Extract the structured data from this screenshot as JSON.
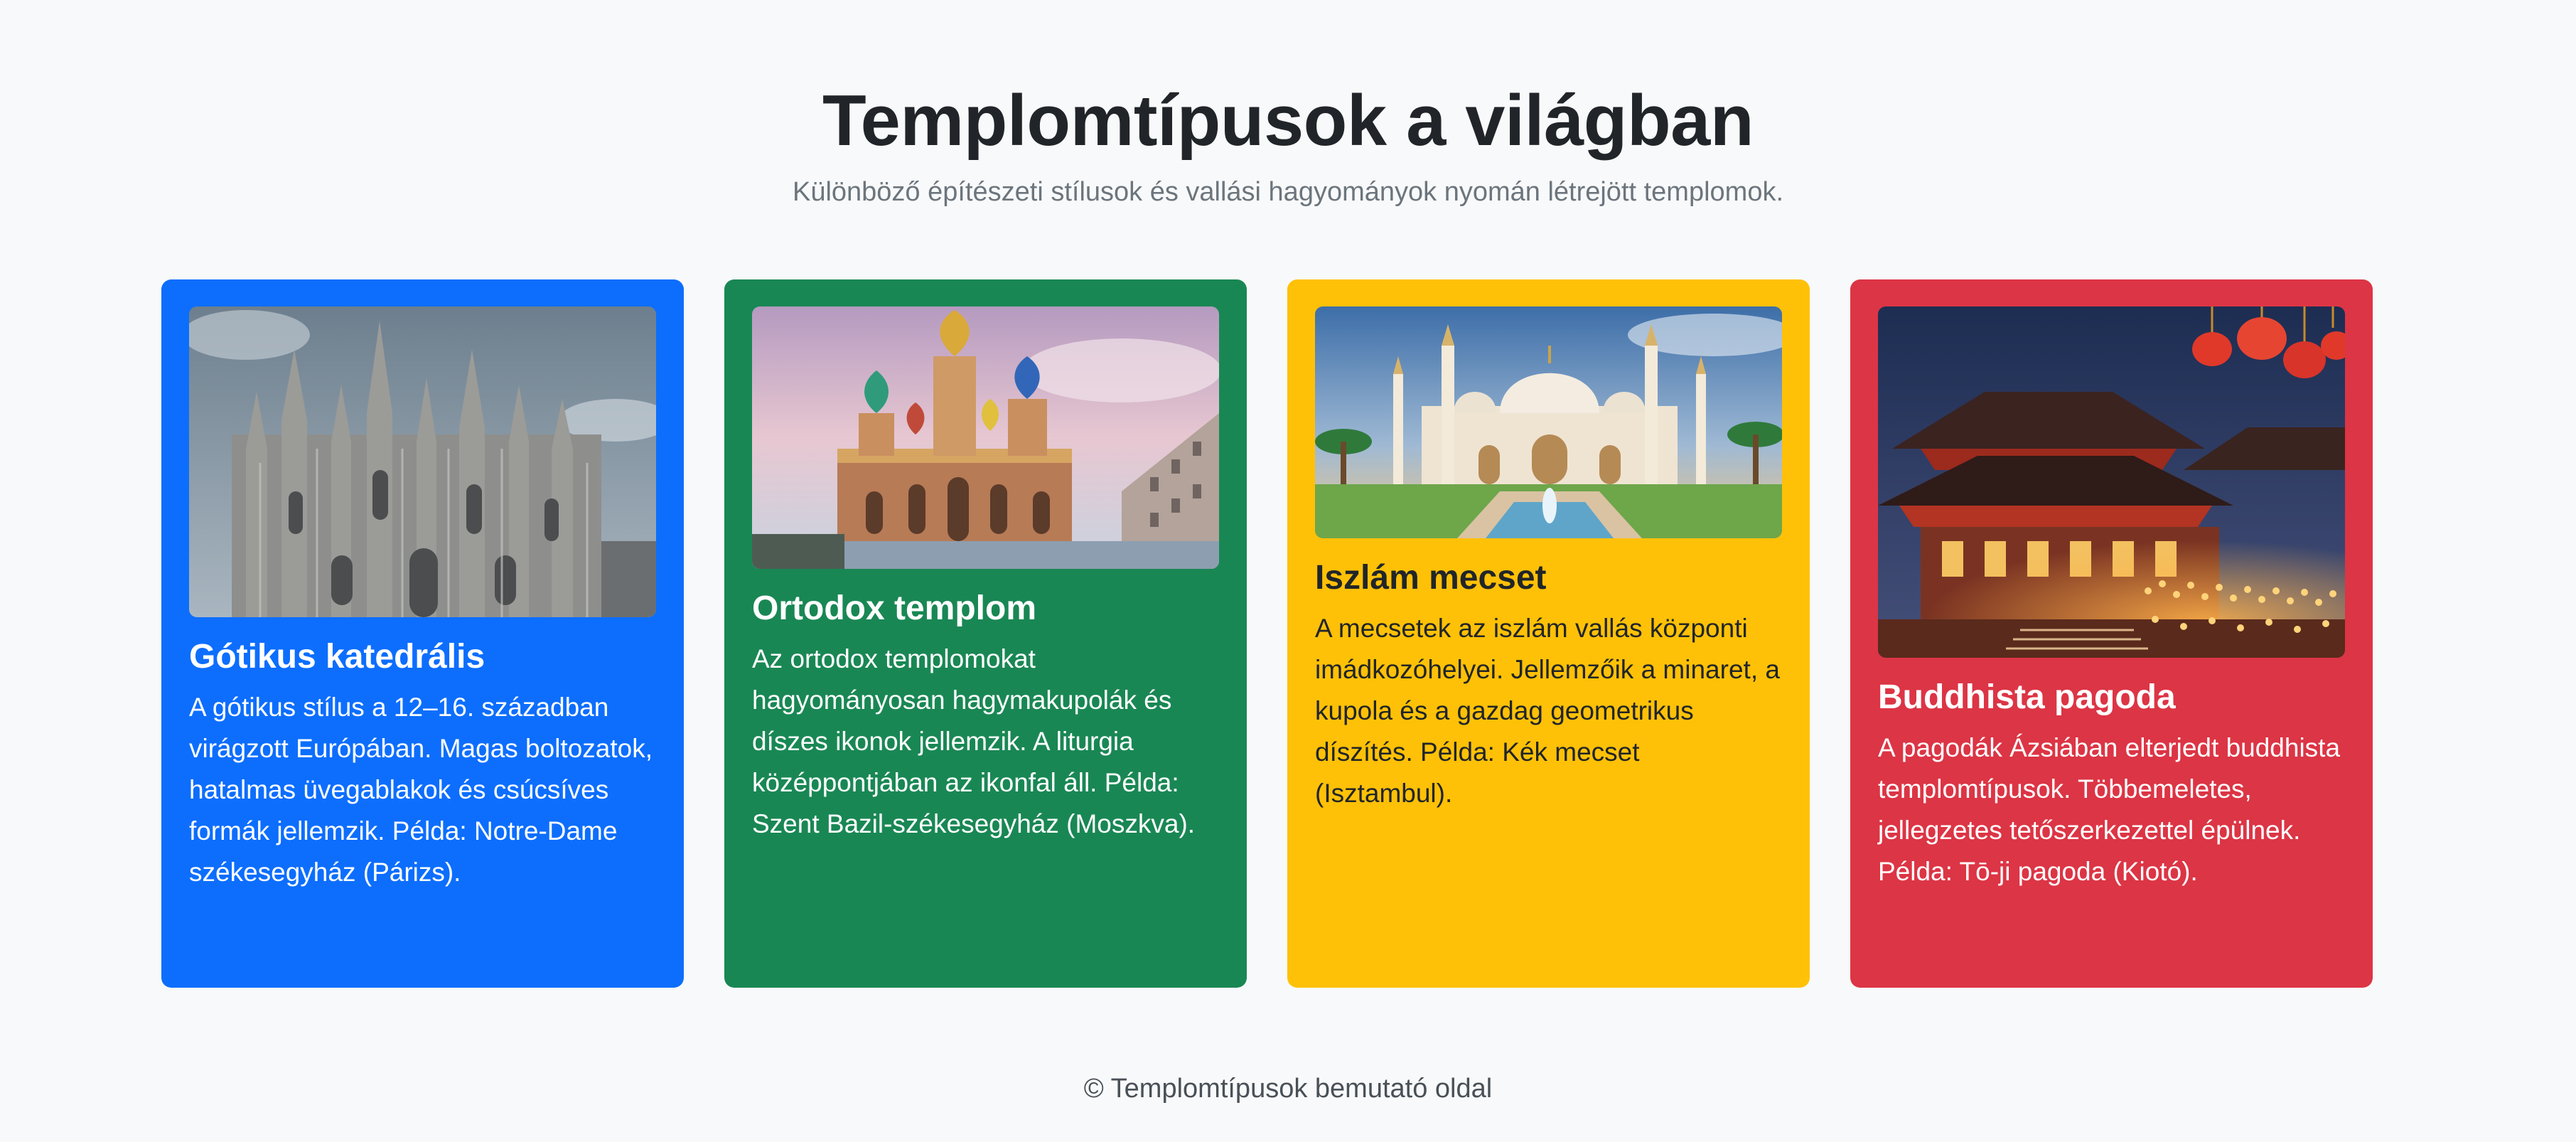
{
  "header": {
    "title": "Templomtípusok a világban",
    "subtitle": "Különböző építészeti stílusok és vallási hagyományok nyomán létrejött templomok."
  },
  "cards": [
    {
      "color": "#0d6efd",
      "image": "gothic-cathedral-photo",
      "title": "Gótikus katedrális",
      "text": "A gótikus stílus a 12–16. században virágzott Európában. Magas boltozatok, hatalmas üvegablakok és csúcsíves formák jellemzik. Példa: Notre-Dame székesegyház (Párizs)."
    },
    {
      "color": "#198754",
      "image": "orthodox-church-photo",
      "title": "Ortodox templom",
      "text": "Az ortodox templomokat hagyományosan hagymakupolák és díszes ikonok jellemzik. A liturgia középpontjában az ikonfal áll. Példa: Szent Bazil-székesegyház (Moszkva)."
    },
    {
      "color": "#ffc107",
      "image": "mosque-photo",
      "title": "Iszlám mecset",
      "text": "A mecsetek az iszlám vallás központi imádkozóhelyei. Jellemzőik a minaret, a kupola és a gazdag geometrikus díszítés. Példa: Kék mecset (Isztambul)."
    },
    {
      "color": "#dc3545",
      "image": "buddhist-pagoda-photo",
      "title": "Buddhista pagoda",
      "text": "A pagodák Ázsiában elterjedt buddhista templomtípusok. Többemeletes, jellegzetes tetőszerkezettel épülnek. Példa: Tō-ji pagoda (Kiotó)."
    }
  ],
  "footer": {
    "text": "© Templomtípusok bemutató oldal"
  }
}
